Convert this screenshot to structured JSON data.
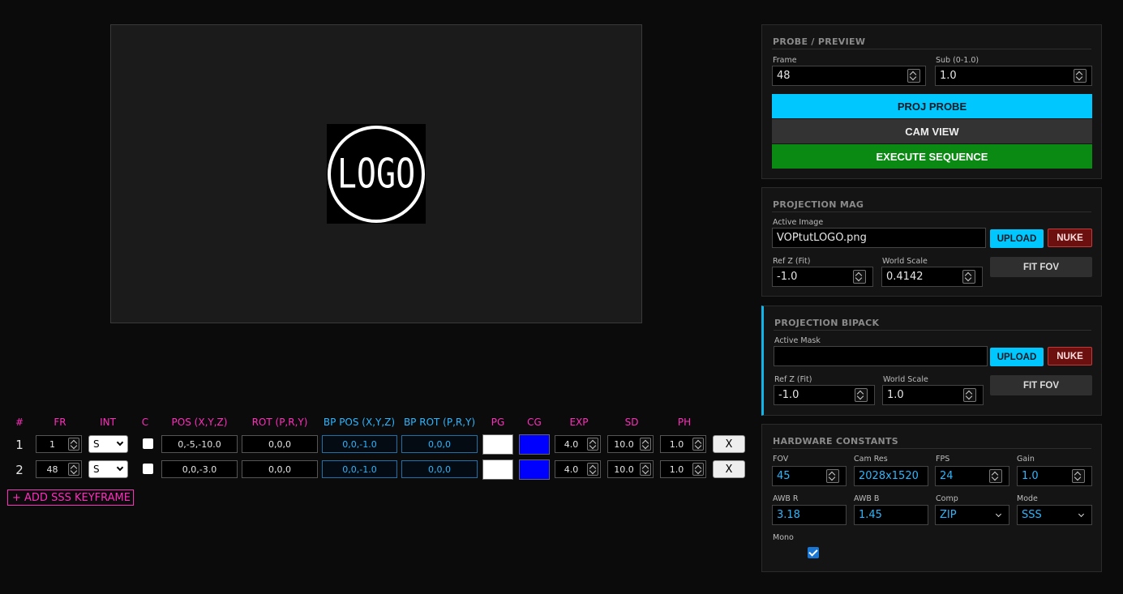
{
  "preview": {
    "logo_text": "LOGO"
  },
  "keyframes": {
    "headers": [
      "#",
      "FR",
      "INT",
      "C",
      "POS (X,Y,Z)",
      "ROT (P,R,Y)",
      "BP POS (X,Y,Z)",
      "BP ROT (P,R,Y)",
      "PG",
      "CG",
      "EXP",
      "SD",
      "PH"
    ],
    "rows": [
      {
        "index": "1",
        "frame": "1",
        "interp": "S",
        "pos": "0,-5,-10.0",
        "rot": "0,0,0",
        "bp_pos": "0,0,-1.0",
        "bp_rot": "0,0,0",
        "pg_color": "#ffffff",
        "cg_color": "#0000ff",
        "exp": "4.0",
        "sd": "10.0",
        "ph": "1.0",
        "delete": "X"
      },
      {
        "index": "2",
        "frame": "48",
        "interp": "S",
        "pos": "0,0,-3.0",
        "rot": "0,0,0",
        "bp_pos": "0,0,-1.0",
        "bp_rot": "0,0,0",
        "pg_color": "#ffffff",
        "cg_color": "#0000ff",
        "exp": "4.0",
        "sd": "10.0",
        "ph": "1.0",
        "delete": "X"
      }
    ],
    "add_label": "+ ADD SSS KEYFRAME"
  },
  "probe": {
    "title": "PROBE / PREVIEW",
    "frame_label": "Frame",
    "frame_value": "48",
    "sub_label": "Sub (0-1.0)",
    "sub_value": "1.0",
    "proj_probe": "PROJ PROBE",
    "cam_view": "CAM VIEW",
    "execute": "EXECUTE SEQUENCE"
  },
  "mag": {
    "title": "PROJECTION MAG",
    "image_label": "Active Image",
    "image_value": "VOPtutLOGO.png",
    "upload": "UPLOAD",
    "nuke": "NUKE",
    "refz_label": "Ref Z (Fit)",
    "refz_value": "-1.0",
    "scale_label": "World Scale",
    "scale_value": "0.4142",
    "fit": "FIT FOV"
  },
  "bipack": {
    "title": "PROJECTION BIPACK",
    "mask_label": "Active Mask",
    "mask_value": "",
    "upload": "UPLOAD",
    "nuke": "NUKE",
    "refz_label": "Ref Z (Fit)",
    "refz_value": "-1.0",
    "scale_label": "World Scale",
    "scale_value": "1.0",
    "fit": "FIT FOV"
  },
  "hardware": {
    "title": "HARDWARE CONSTANTS",
    "fov_label": "FOV",
    "fov_value": "45",
    "camres_label": "Cam Res",
    "camres_value": "2028x1520",
    "fps_label": "FPS",
    "fps_value": "24",
    "gain_label": "Gain",
    "gain_value": "1.0",
    "awbr_label": "AWB R",
    "awbr_value": "3.18",
    "awbb_label": "AWB B",
    "awbb_value": "1.45",
    "comp_label": "Comp",
    "comp_value": "ZIP",
    "mode_label": "Mode",
    "mode_value": "SSS",
    "mono_label": "Mono",
    "mono_checked": true
  },
  "colors": {
    "accent_cyan": "#00c8ff",
    "header_magenta": "#ff2dbd",
    "header_blue": "#2bb6ff",
    "execute_green": "#0a8a12",
    "nuke_red": "#6b0f0f",
    "cam_view_gray": "#333333"
  }
}
